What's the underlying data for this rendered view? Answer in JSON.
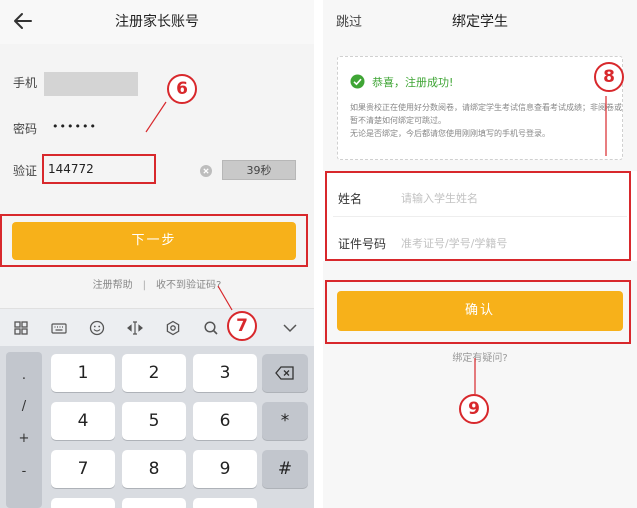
{
  "left_screen": {
    "back_icon": "arrow-left-icon",
    "title": "注册家长账号",
    "phone_label": "手机",
    "password_label": "密码",
    "password_mask": "••••••",
    "code_label": "验证",
    "code_value": "144772",
    "clear_icon": "clear-circle-icon",
    "countdown": "39秒",
    "next_button": "下一步",
    "help_link": "注册帮助",
    "link_separator": "|",
    "no_code_link": "收不到验证码?",
    "keyboard_toolbar_icons": [
      "grid-icon",
      "keyboard-icon",
      "emoji-icon",
      "cursor-icon",
      "settings-icon",
      "search-icon",
      "collapse-chevron-icon"
    ],
    "keyboard": {
      "side_symbols": [
        ".",
        "/",
        "+",
        "-"
      ],
      "row1": [
        "1",
        "2",
        "3"
      ],
      "row2": [
        "4",
        "5",
        "6"
      ],
      "row3": [
        "7",
        "8",
        "9"
      ],
      "backspace_icon": "backspace-icon",
      "star": "*",
      "hash": "#"
    },
    "badge_6": "6",
    "badge_7": "7"
  },
  "right_screen": {
    "skip_link": "跳过",
    "title": "绑定学生",
    "check_icon": "check-circle-icon",
    "success_message": "恭喜，注册成功!",
    "notice_lines": [
      "如果贵校正在使用好分数阅卷，请绑定学生考试信息查看考试成绩；非阅卷或暂不清楚如何绑定可跳过。",
      "无论是否绑定，今后都请您使用刚刚填写的手机号登录。"
    ],
    "name_label": "姓名",
    "name_placeholder": "请输入学生姓名",
    "id_label": "证件号码",
    "id_placeholder": "准考证号/学号/学籍号",
    "confirm_button": "确认",
    "bind_question_link": "绑定有疑问?",
    "badge_8": "8",
    "badge_9": "9"
  },
  "colors": {
    "accent_yellow": "#f7b11a",
    "highlight_red": "#d8282c",
    "success_green": "#3fa535"
  }
}
